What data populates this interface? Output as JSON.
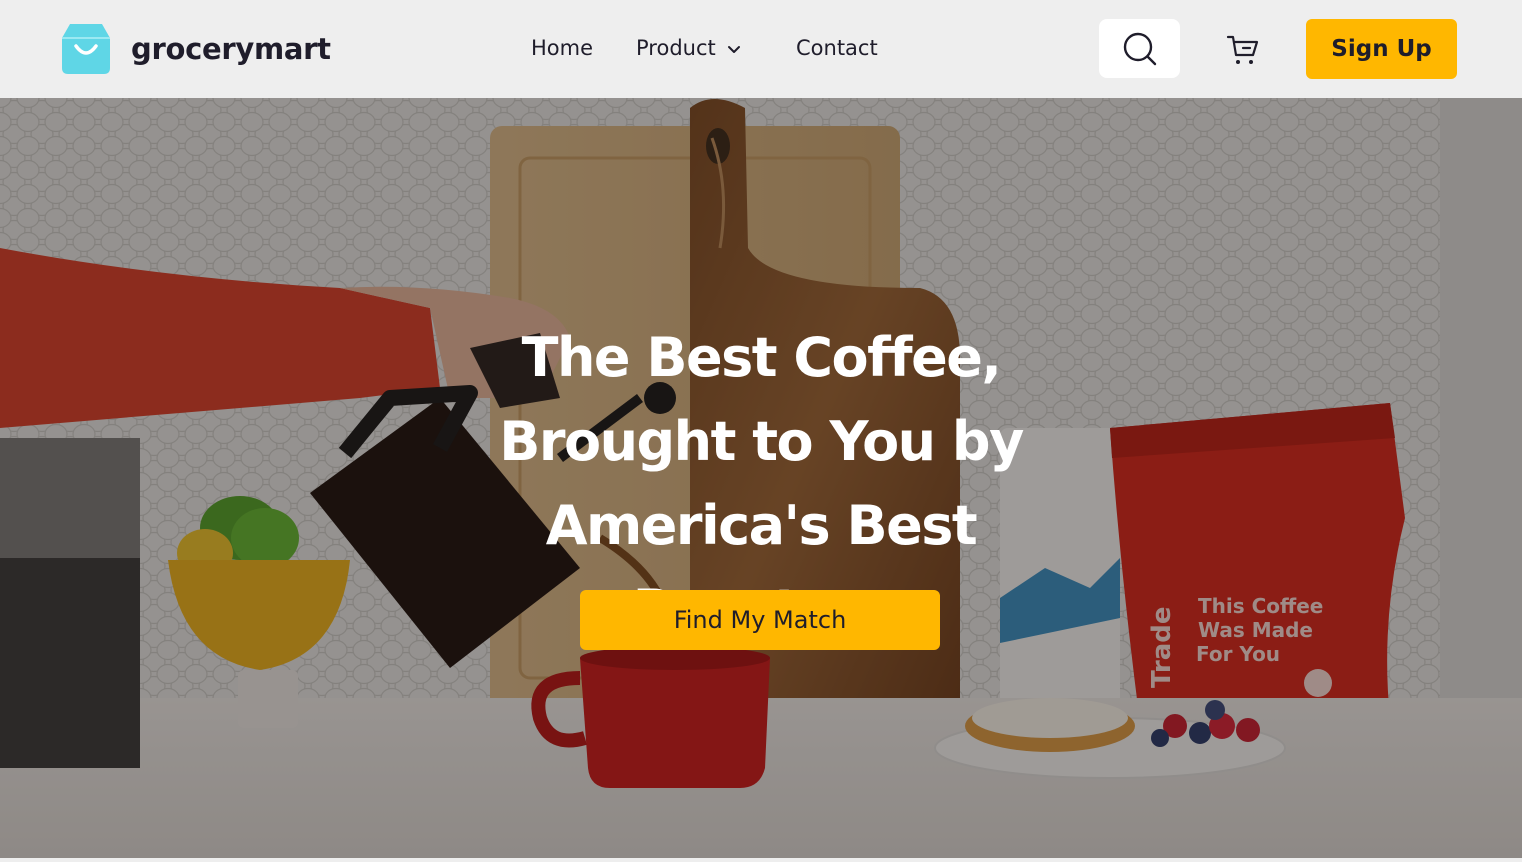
{
  "brand": {
    "name": "grocerymart"
  },
  "nav": {
    "home": "Home",
    "product": "Product",
    "contact": "Contact"
  },
  "actions": {
    "search_icon": "search-icon",
    "cart_icon": "cart-icon",
    "signup_label": "Sign Up"
  },
  "hero": {
    "title_lines": [
      "The Best Coffee,",
      "Brought to You by",
      "America's Best Roasters"
    ],
    "cta_label": "Find My Match",
    "bag_text": [
      "This Coffee",
      "Was Made",
      "For You"
    ],
    "bag_brand": "Trade"
  },
  "colors": {
    "accent": "#ffb700",
    "header_bg": "#eeeeee",
    "logo": "#5fd6e6",
    "text_dark": "#1f1d2b"
  }
}
